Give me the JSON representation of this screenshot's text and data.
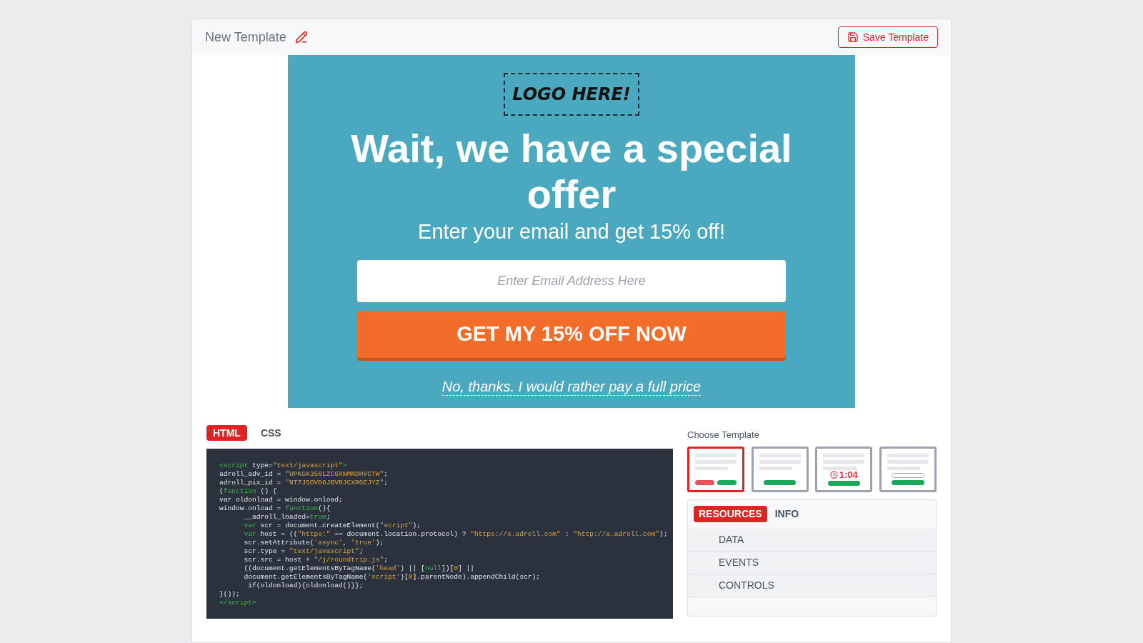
{
  "header": {
    "title": "New Template",
    "save_button": "Save Template"
  },
  "preview": {
    "logo": "LOGO HERE!",
    "headline": "Wait, we have a special offer",
    "subheadline": "Enter your email and get 15% off!",
    "email_field": {
      "placeholder": "Enter Email Address Here"
    },
    "cta_button": "GET MY 15% OFF NOW",
    "decline_link": "No, thanks. I would rather pay a full price"
  },
  "editor_tabs": [
    {
      "label": "HTML",
      "selected": true
    },
    {
      "label": "CSS",
      "selected": false
    }
  ],
  "code_lines": [
    [
      {
        "kind": "tag",
        "text": "<script"
      },
      {
        "kind": "plain",
        "text": " type="
      },
      {
        "kind": "string",
        "text": "\"text/javascript\""
      },
      {
        "kind": "tag",
        "text": ">"
      }
    ],
    [
      {
        "kind": "plain",
        "text": "adroll_adv_id = "
      },
      {
        "kind": "string",
        "text": "\"UPKGK356LZC6XNMNDHVCTW\""
      },
      {
        "kind": "plain",
        "text": ";"
      }
    ],
    [
      {
        "kind": "plain",
        "text": "adroll_pix_id = "
      },
      {
        "kind": "string",
        "text": "\"NT7J5OVD6JBVRJCXRGEJYZ\""
      },
      {
        "kind": "plain",
        "text": ";"
      }
    ],
    [
      {
        "kind": "plain",
        "text": "("
      },
      {
        "kind": "keyword",
        "text": "function"
      },
      {
        "kind": "plain",
        "text": " () {"
      }
    ],
    [
      {
        "kind": "plain",
        "text": "var oldonload = window.onload;"
      }
    ],
    [
      {
        "kind": "plain",
        "text": "window.onload = "
      },
      {
        "kind": "keyword",
        "text": "function"
      },
      {
        "kind": "plain",
        "text": "(){"
      }
    ],
    [
      {
        "kind": "plain",
        "text": "      __adroll_loaded="
      },
      {
        "kind": "keyword",
        "text": "true"
      },
      {
        "kind": "plain",
        "text": ";"
      }
    ],
    [
      {
        "kind": "keyword",
        "text": "      var"
      },
      {
        "kind": "plain",
        "text": " scr = document.createElement("
      },
      {
        "kind": "string",
        "text": "\"script\""
      },
      {
        "kind": "plain",
        "text": ");"
      }
    ],
    [
      {
        "kind": "keyword",
        "text": "      var"
      },
      {
        "kind": "plain",
        "text": " host = (("
      },
      {
        "kind": "string",
        "text": "\"https:\""
      },
      {
        "kind": "plain",
        "text": " == document.location.protocol) ? "
      },
      {
        "kind": "string",
        "text": "\"https://s.adroll.com\""
      },
      {
        "kind": "plain",
        "text": " : "
      },
      {
        "kind": "string",
        "text": "\"http://a.adroll.com\""
      },
      {
        "kind": "plain",
        "text": ");"
      }
    ],
    [
      {
        "kind": "plain",
        "text": "      scr.setAttribute("
      },
      {
        "kind": "string",
        "text": "'async'"
      },
      {
        "kind": "plain",
        "text": ", "
      },
      {
        "kind": "string",
        "text": "'true'"
      },
      {
        "kind": "plain",
        "text": ");"
      }
    ],
    [
      {
        "kind": "plain",
        "text": "      scr.type = "
      },
      {
        "kind": "string",
        "text": "\"text/javascript\""
      },
      {
        "kind": "plain",
        "text": ";"
      }
    ],
    [
      {
        "kind": "plain",
        "text": "      scr.src = host + "
      },
      {
        "kind": "string",
        "text": "\"/j/roundtrip.js\""
      },
      {
        "kind": "plain",
        "text": ";"
      }
    ],
    [
      {
        "kind": "plain",
        "text": "      ((document.getElementsByTagName("
      },
      {
        "kind": "string",
        "text": "'head'"
      },
      {
        "kind": "plain",
        "text": ") || ["
      },
      {
        "kind": "keyword",
        "text": "null"
      },
      {
        "kind": "plain",
        "text": "])["
      },
      {
        "kind": "string",
        "text": "0"
      },
      {
        "kind": "plain",
        "text": "] ||"
      }
    ],
    [
      {
        "kind": "plain",
        "text": "      document.getElementsByTagName("
      },
      {
        "kind": "string",
        "text": "'script'"
      },
      {
        "kind": "plain",
        "text": ")["
      },
      {
        "kind": "string",
        "text": "0"
      },
      {
        "kind": "plain",
        "text": "].parentNode).appendChild(scr);"
      }
    ],
    [
      {
        "kind": "plain",
        "text": "       if(oldonload){oldonload()}};"
      }
    ],
    [
      {
        "kind": "plain",
        "text": "}());"
      }
    ],
    [
      {
        "kind": "tag",
        "text": "</script>"
      }
    ]
  ],
  "template_picker": {
    "label": "Choose Template",
    "templates": [
      {
        "kind": "two-buttons",
        "selected": true
      },
      {
        "kind": "button",
        "selected": false
      },
      {
        "kind": "timer",
        "timer": "1:04",
        "selected": false
      },
      {
        "kind": "field",
        "selected": false
      }
    ]
  },
  "resource_tabs": [
    {
      "label": "RESOURCES",
      "selected": true
    },
    {
      "label": "INFO",
      "selected": false
    }
  ],
  "resource_items": [
    "DATA",
    "EVENTS",
    "CONTROLS"
  ]
}
